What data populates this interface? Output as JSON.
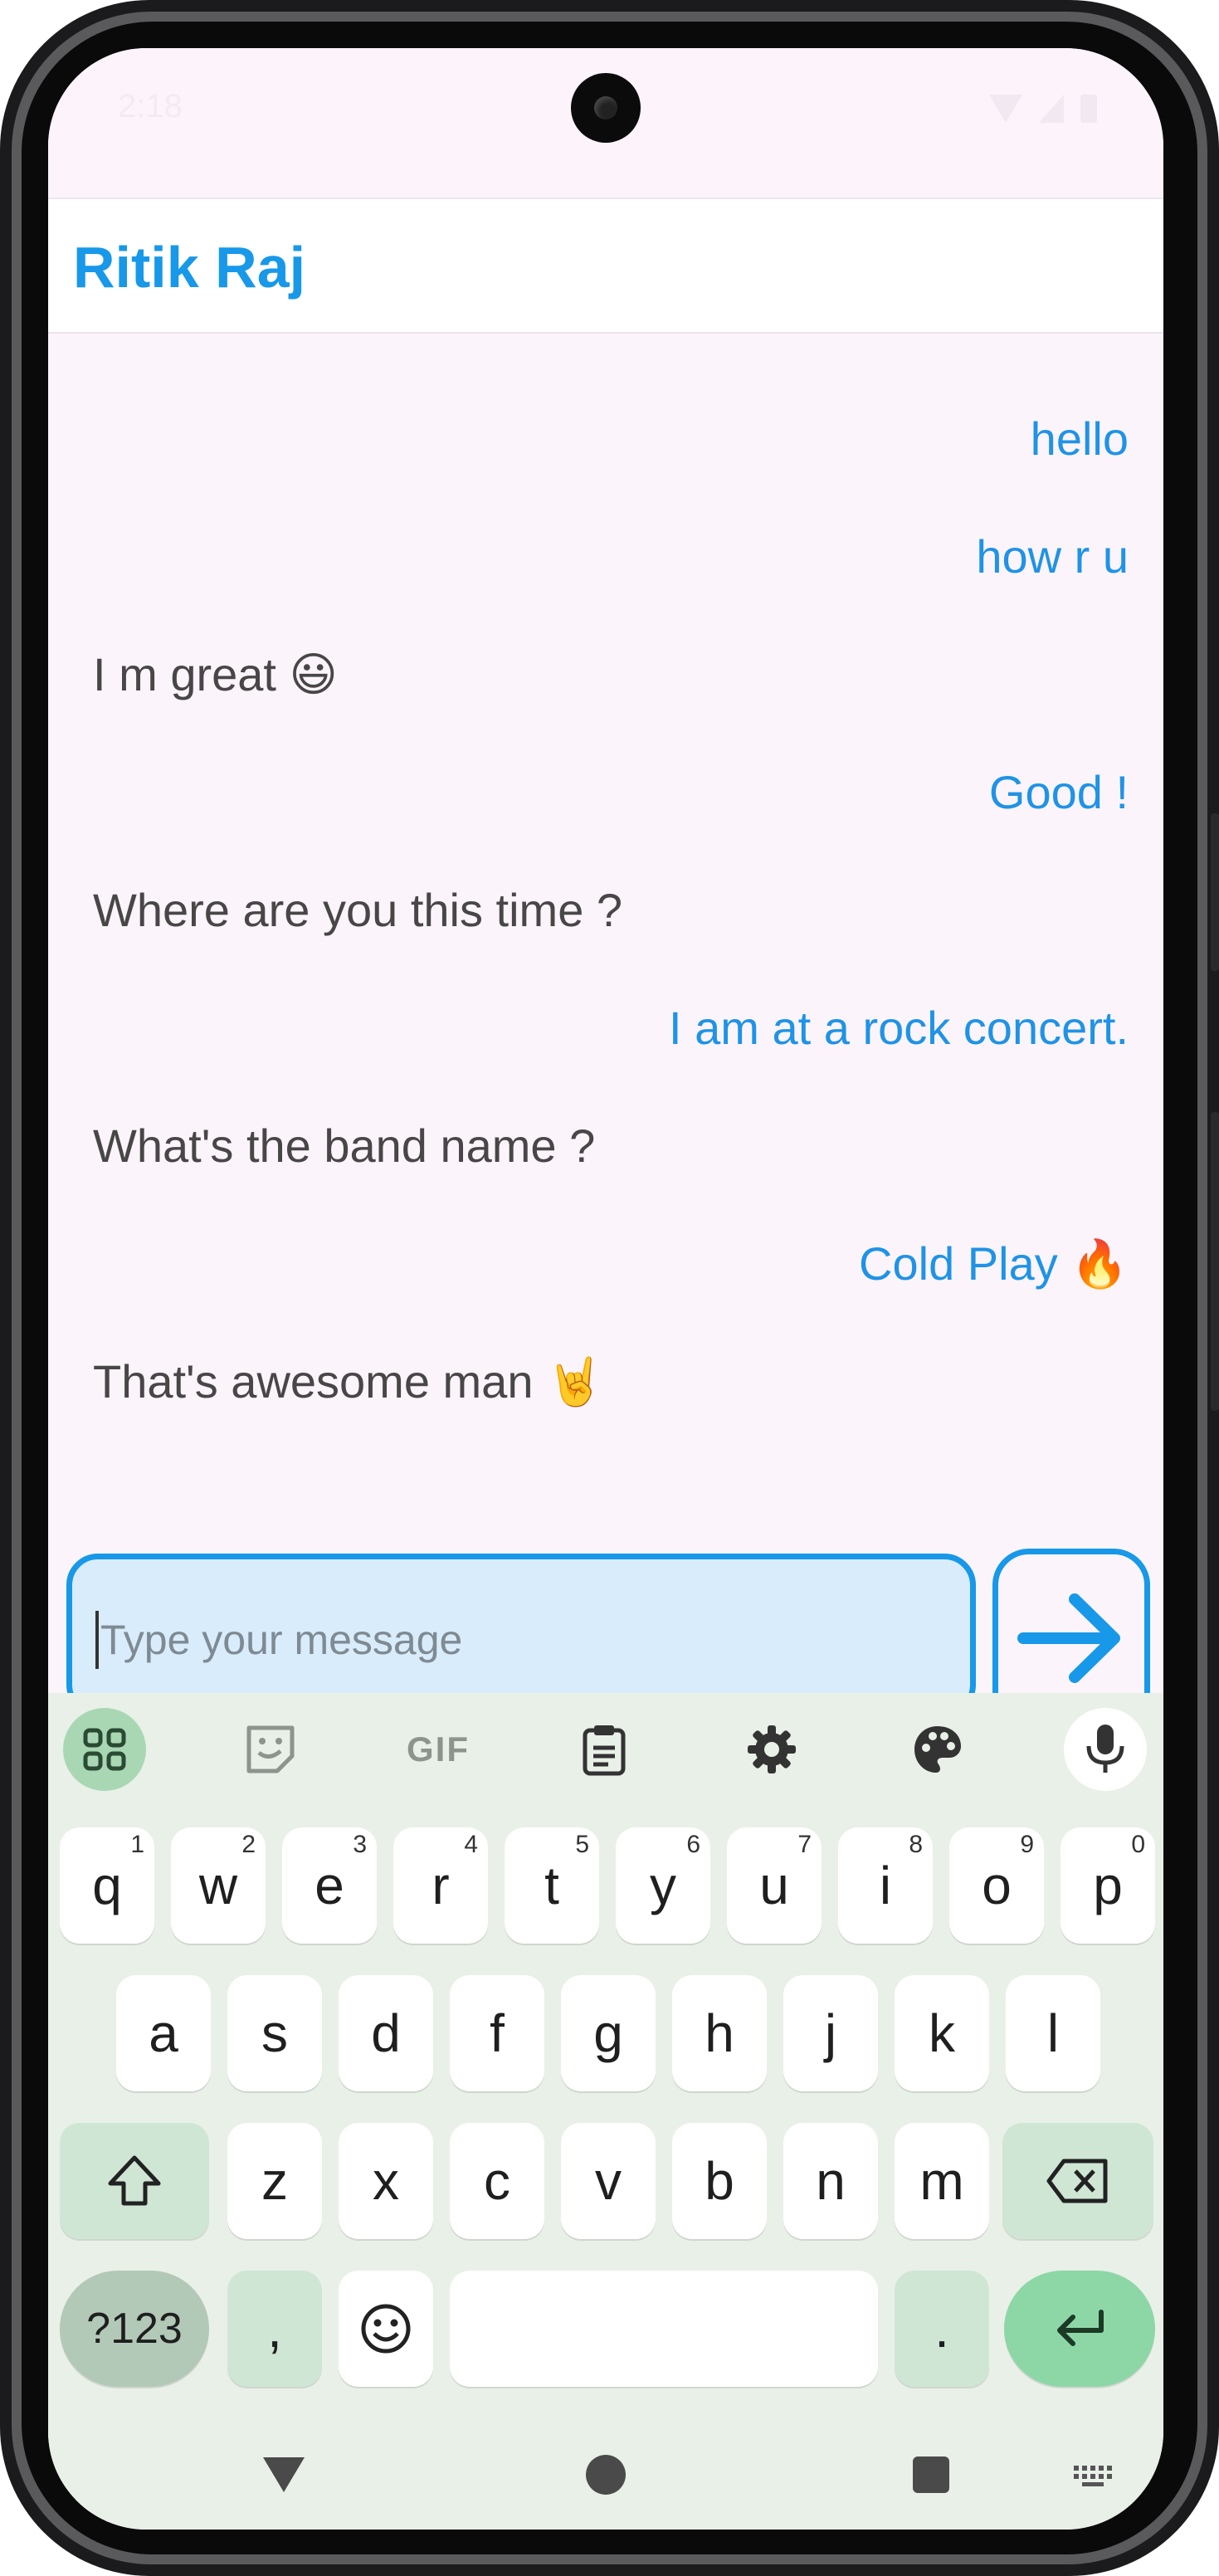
{
  "status_bar": {
    "time": "2:18"
  },
  "app_bar": {
    "title": "Ritik Raj"
  },
  "messages": [
    {
      "text": "hello",
      "sender": "me"
    },
    {
      "text": "how r u",
      "sender": "me"
    },
    {
      "text": "I m great 😃",
      "sender": "other"
    },
    {
      "text": "Good !",
      "sender": "me"
    },
    {
      "text": "Where are you this time ?",
      "sender": "other"
    },
    {
      "text": "I am at a rock concert.",
      "sender": "me"
    },
    {
      "text": "What's the band name ?",
      "sender": "other"
    },
    {
      "text": "Cold Play 🔥",
      "sender": "me"
    },
    {
      "text": "That's awesome man 🤘",
      "sender": "other"
    }
  ],
  "composer": {
    "placeholder": "Type your message",
    "send_icon": "arrow-right-icon"
  },
  "keyboard": {
    "toolbar": [
      "apps-grid-icon",
      "sticker-icon",
      "GIF",
      "clipboard-icon",
      "gear-icon",
      "palette-icon",
      "mic-icon"
    ],
    "gif_label": "GIF",
    "row1": [
      {
        "key": "q",
        "hint": "1"
      },
      {
        "key": "w",
        "hint": "2"
      },
      {
        "key": "e",
        "hint": "3"
      },
      {
        "key": "r",
        "hint": "4"
      },
      {
        "key": "t",
        "hint": "5"
      },
      {
        "key": "y",
        "hint": "6"
      },
      {
        "key": "u",
        "hint": "7"
      },
      {
        "key": "i",
        "hint": "8"
      },
      {
        "key": "o",
        "hint": "9"
      },
      {
        "key": "p",
        "hint": "0"
      }
    ],
    "row2": [
      "a",
      "s",
      "d",
      "f",
      "g",
      "h",
      "j",
      "k",
      "l"
    ],
    "row3": [
      "z",
      "x",
      "c",
      "v",
      "b",
      "n",
      "m"
    ],
    "symbols_label": "?123",
    "comma_label": ",",
    "period_label": ".",
    "colors": {
      "background": "#e9f0e8",
      "modifier": "#cfe6d5",
      "enter": "#8dd7a6"
    }
  },
  "nav_bar": [
    "back-icon",
    "home-icon",
    "recents-icon",
    "keyboard-switch-icon"
  ],
  "colors": {
    "accent": "#1898e8",
    "received_text": "#484646",
    "screen_bg": "#fbf4fb",
    "input_bg": "#d9ecfb"
  }
}
